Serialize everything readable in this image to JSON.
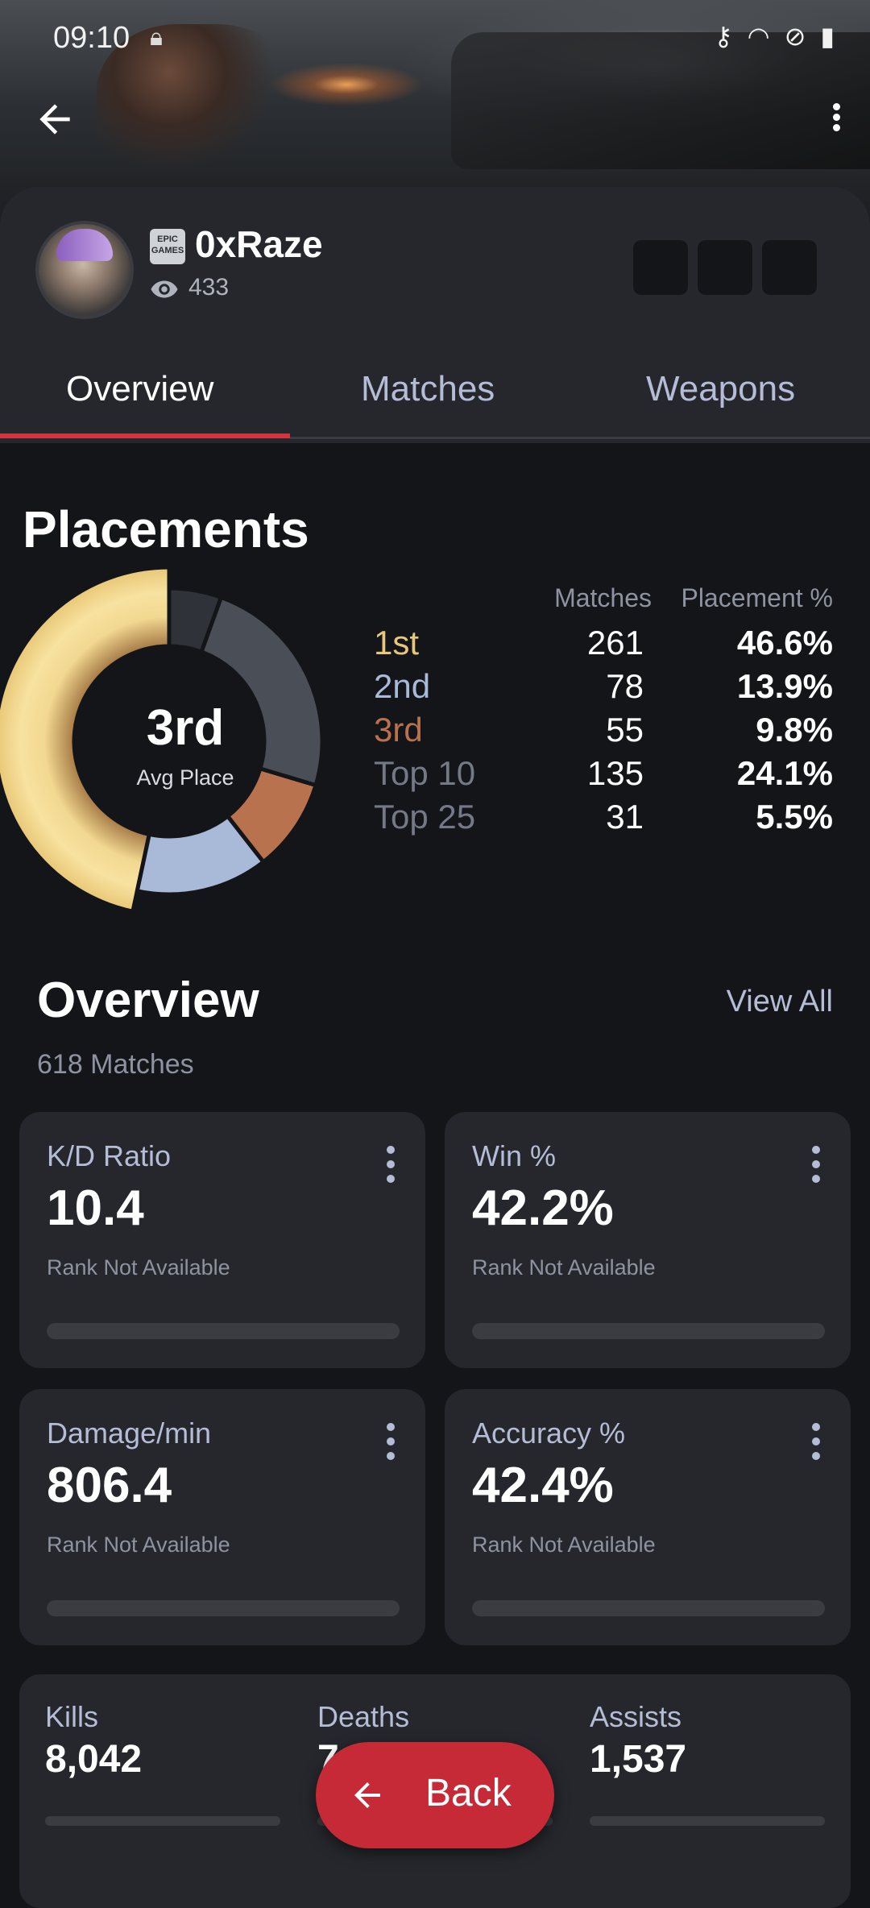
{
  "status_bar": {
    "time": "09:10"
  },
  "profile": {
    "name": "0xRaze",
    "views": "433",
    "platform_icon_text": "EPIC GAMES"
  },
  "tabs": [
    {
      "label": "Overview",
      "active": true
    },
    {
      "label": "Matches",
      "active": false
    },
    {
      "label": "Weapons",
      "active": false
    }
  ],
  "placements": {
    "title": "Placements",
    "avg_place": "3rd",
    "avg_place_label": "Avg Place",
    "col_matches": "Matches",
    "col_percent": "Placement %",
    "rows": [
      {
        "label": "1st",
        "matches": "261",
        "percent": "46.6%",
        "color": "#e7c77a"
      },
      {
        "label": "2nd",
        "matches": "78",
        "percent": "13.9%",
        "color": "#a9bad8"
      },
      {
        "label": "3rd",
        "matches": "55",
        "percent": "9.8%",
        "color": "#b8724e"
      },
      {
        "label": "Top 10",
        "matches": "135",
        "percent": "24.1%",
        "color": "#737986"
      },
      {
        "label": "Top 25",
        "matches": "31",
        "percent": "5.5%",
        "color": "#737986"
      }
    ]
  },
  "chart_data": {
    "type": "pie",
    "categories": [
      "1st",
      "2nd",
      "3rd",
      "Top 10",
      "Top 25"
    ],
    "values": [
      46.6,
      13.9,
      9.8,
      24.1,
      5.5
    ],
    "colors": [
      "#f0d58c",
      "#a9bad8",
      "#b8724e",
      "#4a4f57",
      "#2f3238"
    ]
  },
  "overview": {
    "title": "Overview",
    "view_all": "View All",
    "matches": "618 Matches",
    "cards": [
      {
        "label": "K/D Ratio",
        "value": "10.4",
        "rank": "Rank Not Available"
      },
      {
        "label": "Win %",
        "value": "42.2%",
        "rank": "Rank Not Available"
      },
      {
        "label": "Damage/min",
        "value": "806.4",
        "rank": "Rank Not Available"
      },
      {
        "label": "Accuracy %",
        "value": "42.4%",
        "rank": "Rank Not Available"
      }
    ],
    "totals": [
      {
        "label": "Kills",
        "value": "8,042"
      },
      {
        "label": "Deaths",
        "value": "7"
      },
      {
        "label": "Assists",
        "value": "1,537"
      }
    ]
  },
  "fab": {
    "label": "Back"
  }
}
